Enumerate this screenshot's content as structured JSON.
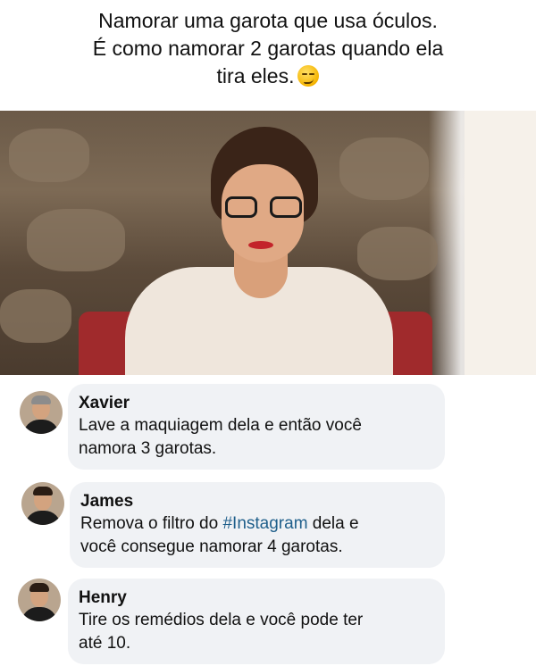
{
  "caption": {
    "lines": [
      "Namorar uma garota que usa óculos.",
      "É como namorar 2 garotas quando ela",
      "tira eles."
    ],
    "emoji": "smirking-face-emoji"
  },
  "photo": {
    "description_icon": "woman-with-glasses-photo"
  },
  "comments": [
    {
      "name": "Xavier",
      "text_line1": "Lave a maquiagem dela e então você",
      "text_line2": "namora 3 garotas."
    },
    {
      "name": "James",
      "text_prefix": "Remova o filtro do ",
      "hashtag": "#Instagram",
      "text_suffix": " dela e",
      "text_line2": "você consegue namorar 4 garotas."
    },
    {
      "name": "Henry",
      "text_line1": "Tire os remédios dela e você pode ter",
      "text_line2": "até 10."
    }
  ],
  "colors": {
    "bubble_bg": "#f0f2f5",
    "hashtag": "#1f5f8b"
  }
}
